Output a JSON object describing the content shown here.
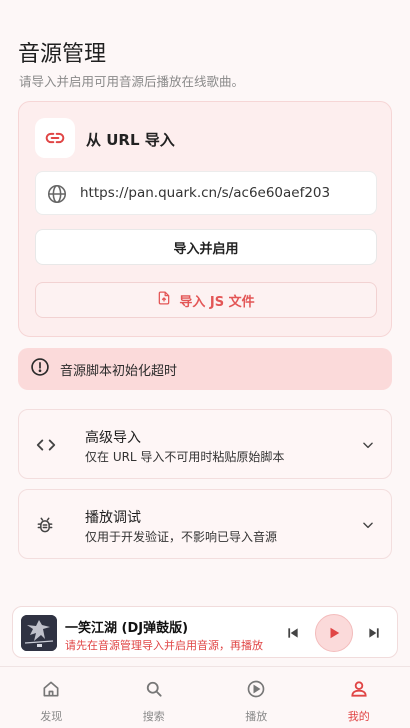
{
  "page": {
    "title": "音源管理",
    "subtitle": "请导入并启用可用音源后播放在线歌曲。"
  },
  "url_card": {
    "icon": "link-icon",
    "title": "从 URL 导入",
    "url_value": "https://pan.quark.cn/s/ac6e60aef203",
    "import_enable_label": "导入并启用",
    "import_js_label": "导入 JS 文件"
  },
  "error": {
    "message": "音源脚本初始化超时",
    "color": "#fbdada"
  },
  "panels": [
    {
      "icon": "code-icon",
      "title": "高级导入",
      "desc": "仅在 URL 导入不可用时粘贴原始脚本"
    },
    {
      "icon": "bug-icon",
      "title": "播放调试",
      "desc": "仅用于开发验证，不影响已导入音源"
    }
  ],
  "player": {
    "song_title": "一笑江湖 (DJ弹鼓版)",
    "hint": "请先在音源管理导入并启用音源，再播放"
  },
  "tabs": [
    {
      "label": "发现",
      "icon": "home-icon"
    },
    {
      "label": "搜索",
      "icon": "search-icon"
    },
    {
      "label": "播放",
      "icon": "play-circle-icon"
    },
    {
      "label": "我的",
      "icon": "user-icon",
      "active": true
    }
  ],
  "colors": {
    "accent": "#e04545",
    "background": "#fdf7f7"
  }
}
